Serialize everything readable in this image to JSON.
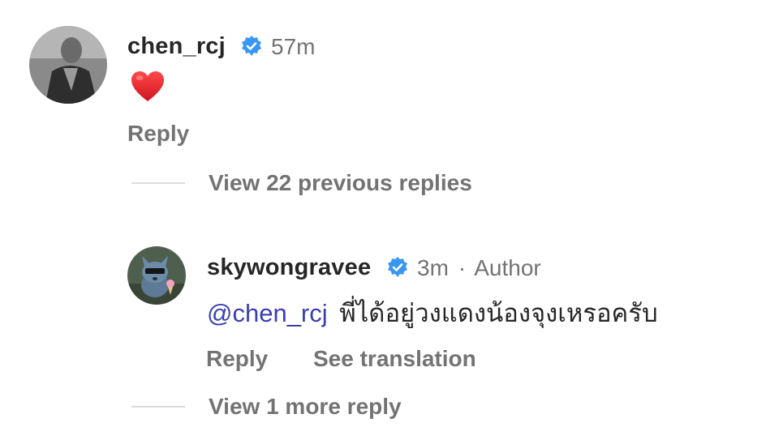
{
  "comment1": {
    "username": "chen_rcj",
    "verified_icon": "verified-badge-icon",
    "time": "57m",
    "body_emoji": "heart-emoji",
    "reply_label": "Reply"
  },
  "thread1": {
    "view_replies_label": "View 22 previous replies"
  },
  "reply1": {
    "username": "skywongravee",
    "verified_icon": "verified-badge-icon",
    "time": "3m",
    "separator": "·",
    "author_label": "Author",
    "mention": "@chen_rcj",
    "text": "พี่ได้อยู่วงแดงน้องจุงเหรอครับ",
    "reply_label": "Reply",
    "translate_label": "See translation"
  },
  "thread2": {
    "view_replies_label": "View 1 more reply"
  },
  "colors": {
    "verified_blue": "#3897f0",
    "heart_red": "#e0202a",
    "mention_blue": "#3a3fb0",
    "secondary_text": "#737373"
  }
}
